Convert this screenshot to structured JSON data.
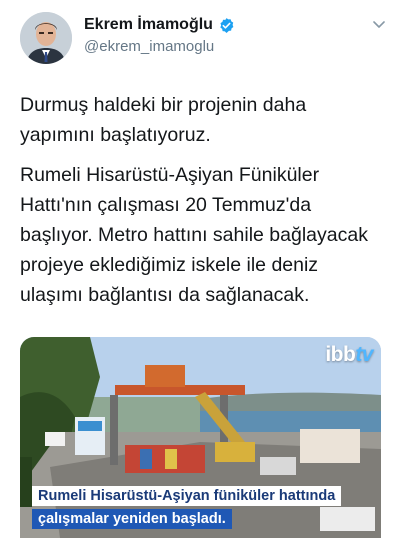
{
  "user": {
    "display_name": "Ekrem İmamoğlu",
    "handle": "@ekrem_imamoglu",
    "verified_icon": "verified-badge-icon",
    "verified_color": "#1da1f2"
  },
  "tweet": {
    "paragraphs": [
      "Durmuş haldeki bir projenin daha yapımını başlatıyoruz.",
      "Rumeli Hisarüstü-Aşiyan Füniküler Hattı'nın çalışması 20 Temmuz'da başlıyor. Metro hattını sahile bağlayacak projeye eklediğimiz iskele ile deniz ulaşımı bağlantısı da sağlanacak."
    ]
  },
  "media": {
    "logo_main": "ibb",
    "logo_suffix": "tv",
    "caption_line_1": "Rumeli Hisarüstü-Aşiyan füniküler hattında",
    "caption_line_2": "çalışmalar yeniden başladı."
  },
  "colors": {
    "text": "#14171a",
    "secondary_text": "#657786",
    "caption_blue": "#1f58b5"
  }
}
